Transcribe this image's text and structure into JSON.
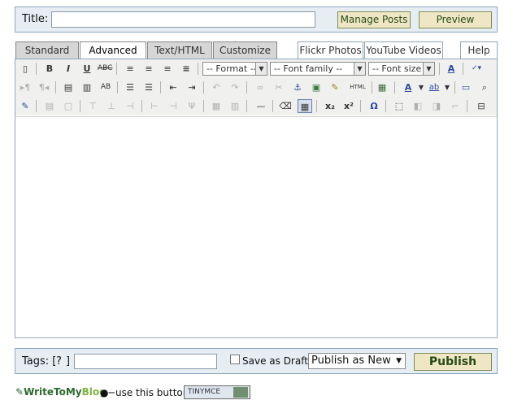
{
  "title_panel": {
    "label": "Title:",
    "value": "",
    "manage_label": "Manage Posts",
    "preview_label": "Preview"
  },
  "tabs": {
    "standard": "Standard",
    "advanced": "Advanced",
    "text_html": "Text/HTML",
    "customize": "Customize",
    "flickr": "Flickr Photos",
    "youtube": "YouTube Videos",
    "help": "Help"
  },
  "toolbar": {
    "format_placeholder": "-- Format --",
    "font_family_placeholder": "-- Font family --",
    "font_size_placeholder": "-- Font size --",
    "html_label": "HTML"
  },
  "editor": {
    "content": ""
  },
  "tags_panel": {
    "label": "Tags: [",
    "help": "?",
    "help_close": "]",
    "value": "",
    "draft_label": "Save as Draft",
    "publish_option": "Publish as New",
    "publish_label": "Publish"
  },
  "footer": {
    "logo_main": "WriteToMy",
    "logo_blog": "Blog",
    "hint": "use this button",
    "tinymce": "TINYMCE"
  }
}
